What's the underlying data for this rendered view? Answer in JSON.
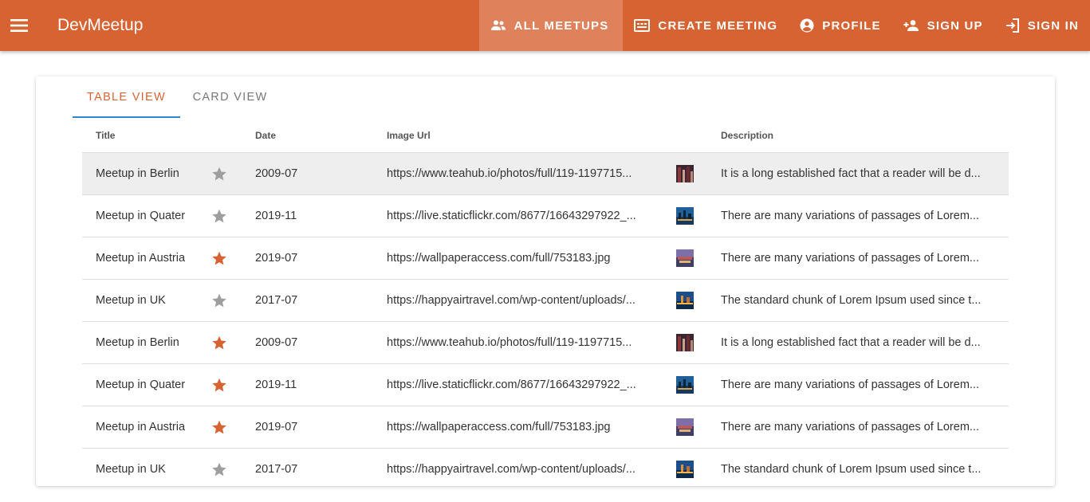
{
  "app": {
    "title": "DevMeetup"
  },
  "colors": {
    "primary": "#d86332",
    "star_off": "#9e9e9e",
    "tab_underline": "#2b86cf"
  },
  "nav": [
    {
      "label": "ALL MEETUPS",
      "icon": "group-icon",
      "active": true
    },
    {
      "label": "CREATE MEETING",
      "icon": "create-meeting-icon",
      "active": false
    },
    {
      "label": "PROFILE",
      "icon": "account-circle-icon",
      "active": false
    },
    {
      "label": "SIGN UP",
      "icon": "person-add-icon",
      "active": false
    },
    {
      "label": "SIGN IN",
      "icon": "login-icon",
      "active": false
    }
  ],
  "tabs": [
    {
      "label": "TABLE VIEW",
      "active": true
    },
    {
      "label": "CARD VIEW",
      "active": false
    }
  ],
  "table": {
    "columns": [
      "Title",
      "Date",
      "Image Url",
      "Description"
    ],
    "rows": [
      {
        "title": "Meetup in Berlin",
        "favorite": false,
        "date": "2009-07",
        "url": "https://www.teahub.io/photos/full/119-1197715...",
        "thumb": "berlin",
        "description": "It is a long established fact that a reader will be d..."
      },
      {
        "title": "Meetup in Quater",
        "favorite": false,
        "date": "2019-11",
        "url": "https://live.staticflickr.com/8677/16643297922_...",
        "thumb": "quater",
        "description": "There are many variations of passages of Lorem..."
      },
      {
        "title": "Meetup in Austria",
        "favorite": true,
        "date": "2019-07",
        "url": "https://wallpaperaccess.com/full/753183.jpg",
        "thumb": "austria",
        "description": "There are many variations of passages of Lorem..."
      },
      {
        "title": "Meetup in UK",
        "favorite": false,
        "date": "2017-07",
        "url": "https://happyairtravel.com/wp-content/uploads/...",
        "thumb": "uk",
        "description": "The standard chunk of Lorem Ipsum used since t..."
      },
      {
        "title": "Meetup in Berlin",
        "favorite": true,
        "date": "2009-07",
        "url": "https://www.teahub.io/photos/full/119-1197715...",
        "thumb": "berlin",
        "description": "It is a long established fact that a reader will be d..."
      },
      {
        "title": "Meetup in Quater",
        "favorite": true,
        "date": "2019-11",
        "url": "https://live.staticflickr.com/8677/16643297922_...",
        "thumb": "quater",
        "description": "There are many variations of passages of Lorem..."
      },
      {
        "title": "Meetup in Austria",
        "favorite": true,
        "date": "2019-07",
        "url": "https://wallpaperaccess.com/full/753183.jpg",
        "thumb": "austria",
        "description": "There are many variations of passages of Lorem..."
      },
      {
        "title": "Meetup in UK",
        "favorite": false,
        "date": "2017-07",
        "url": "https://happyairtravel.com/wp-content/uploads/...",
        "thumb": "uk",
        "description": "The standard chunk of Lorem Ipsum used since t..."
      }
    ]
  }
}
